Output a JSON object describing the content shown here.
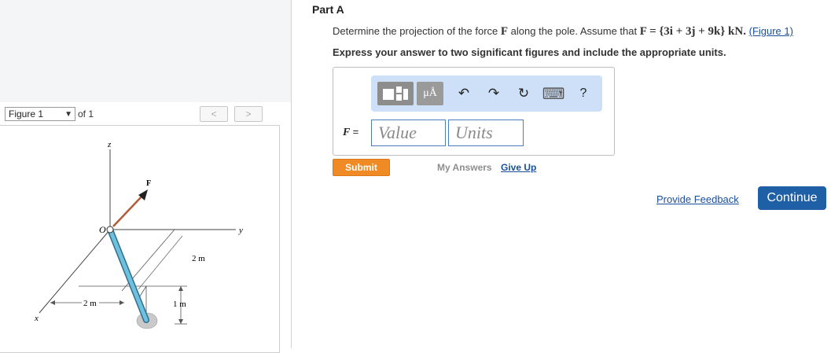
{
  "figure_panel": {
    "select_value": "Figure 1",
    "of_text": "of 1",
    "prev_label": "<",
    "next_label": ">",
    "labels": {
      "z": "z",
      "y": "y",
      "x": "x",
      "origin": "O",
      "force": "F",
      "dim_2m_right": "2 m",
      "dim_1m": "1 m",
      "dim_2m_left": "2 m"
    }
  },
  "part": {
    "title": "Part A",
    "question_text": "Determine the projection of the force ",
    "question_F": "F",
    "question_mid": " along the pole. Assume that ",
    "question_math": "F = {3i + 3j + 9k} kN.",
    "figure_link": "(Figure 1)",
    "instruction": "Express your answer to two significant figures and include the appropriate units."
  },
  "toolbar": {
    "units_tool": "μÅ",
    "undo": "↶",
    "redo": "↷",
    "reset": "↻",
    "keyboard": "⌨",
    "help": "?"
  },
  "answer": {
    "label": "F",
    "equals": "=",
    "value_placeholder": "Value",
    "units_placeholder": "Units"
  },
  "actions": {
    "submit": "Submit",
    "my_answers": "My Answers",
    "give_up": "Give Up",
    "feedback": "Provide Feedback",
    "continue": "Continue"
  },
  "colors": {
    "submit": "#f08a24",
    "continue": "#1f5fa6",
    "toolbar_bg": "#cde0f7",
    "link": "#1a4f9c",
    "pole": "#4aa3c8"
  }
}
